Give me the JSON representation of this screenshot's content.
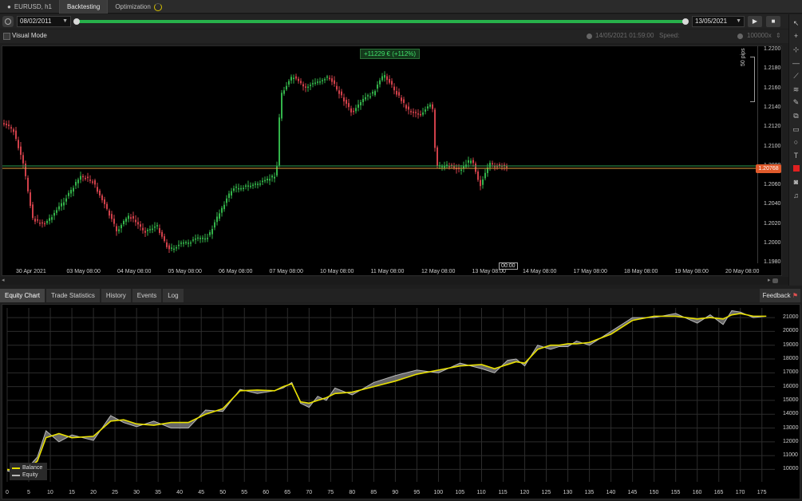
{
  "tabs": [
    {
      "label": "EURUSD, h1",
      "active": false
    },
    {
      "label": "Backtesting",
      "active": true
    },
    {
      "label": "Optimization",
      "active": false
    }
  ],
  "toolbar": {
    "start_date": "08/02/2011",
    "end_date": "13/05/2021",
    "play_icon": "▶",
    "stop_icon": "■"
  },
  "visual_mode": {
    "label": "Visual Mode",
    "checked": false,
    "current_time": "14/05/2021 01:59:00",
    "speed_label": "Speed:",
    "speed_value": "100000x"
  },
  "chart": {
    "pnl_label": "+11229 € (+112%)",
    "current_price": "1.20768",
    "pips_label": "50 pips",
    "time_marker": "00:00",
    "price_axis": [
      "1.2200",
      "1.2180",
      "1.2160",
      "1.2140",
      "1.2120",
      "1.2100",
      "1.2080",
      "1.2060",
      "1.2040",
      "1.2020",
      "1.2000",
      "1.1980"
    ],
    "time_axis": [
      "30 Apr 2021",
      "03 May 08:00",
      "04 May 08:00",
      "05 May 08:00",
      "06 May 08:00",
      "07 May 08:00",
      "10 May 08:00",
      "11 May 08:00",
      "12 May 08:00",
      "13 May 08:00",
      "14 May 08:00",
      "17 May 08:00",
      "18 May 08:00",
      "19 May 08:00",
      "20 May 08:00"
    ],
    "colors": {
      "bull": "#33b34a",
      "bear": "#d0404a",
      "price_line": "#e0a040",
      "green_line": "#30a050"
    }
  },
  "chart_data": {
    "type": "line",
    "title": "",
    "xlabel": "",
    "ylabel": "",
    "x_ticks": [
      0,
      5,
      10,
      15,
      20,
      25,
      30,
      35,
      40,
      45,
      50,
      55,
      60,
      65,
      70,
      75,
      80,
      85,
      90,
      95,
      100,
      105,
      110,
      115,
      120,
      125,
      130,
      135,
      140,
      145,
      150,
      155,
      160,
      165,
      170,
      175
    ],
    "y_ticks": [
      10000,
      11000,
      12000,
      13000,
      14000,
      15000,
      16000,
      17000,
      18000,
      19000,
      20000,
      21000
    ],
    "xlim": [
      0,
      178
    ],
    "ylim": [
      9100,
      21700
    ],
    "legend": "bottom-left",
    "grid": true,
    "series": [
      {
        "name": "Balance",
        "color": "#e8e000",
        "x": [
          0,
          3,
          5,
          7,
          9,
          12,
          15,
          20,
          24,
          27,
          30,
          34,
          38,
          42,
          46,
          50,
          54,
          58,
          62,
          64,
          66,
          68,
          70,
          72,
          74,
          76,
          80,
          85,
          90,
          95,
          100,
          105,
          110,
          113,
          116,
          118,
          120,
          123,
          126,
          128,
          130,
          132,
          135,
          140,
          145,
          150,
          155,
          160,
          163,
          166,
          168,
          170,
          173,
          176
        ],
        "values": [
          10000,
          9900,
          10100,
          10600,
          12300,
          12600,
          12300,
          12400,
          13500,
          13600,
          13300,
          13200,
          13400,
          13400,
          14000,
          14400,
          15700,
          15750,
          15700,
          16000,
          16200,
          14900,
          14800,
          15000,
          15200,
          15500,
          15600,
          16000,
          16400,
          16900,
          17200,
          17500,
          17600,
          17300,
          17600,
          17800,
          17700,
          18700,
          19000,
          19000,
          19100,
          19100,
          19200,
          19800,
          20800,
          21100,
          21100,
          20900,
          21000,
          20900,
          21200,
          21300,
          21100,
          21100
        ]
      },
      {
        "name": "Equity",
        "color": "#b8b8b8",
        "x": [
          0,
          3,
          5,
          7,
          9,
          12,
          15,
          20,
          24,
          27,
          30,
          34,
          38,
          42,
          46,
          50,
          54,
          58,
          62,
          64,
          66,
          68,
          70,
          72,
          74,
          76,
          80,
          85,
          90,
          95,
          100,
          105,
          110,
          113,
          116,
          118,
          120,
          123,
          126,
          128,
          130,
          132,
          135,
          140,
          145,
          150,
          155,
          160,
          163,
          166,
          168,
          170,
          173,
          176
        ],
        "values": [
          9900,
          9600,
          10200,
          10900,
          12800,
          12000,
          12500,
          12100,
          13900,
          13400,
          13100,
          13500,
          13000,
          13000,
          14300,
          14200,
          15800,
          15500,
          15700,
          15900,
          16300,
          14800,
          14500,
          15300,
          15000,
          15900,
          15400,
          16300,
          16800,
          17200,
          17000,
          17700,
          17300,
          17000,
          17900,
          18000,
          17500,
          19000,
          18700,
          18900,
          18900,
          19300,
          19000,
          20000,
          21000,
          21000,
          21300,
          20600,
          21200,
          20500,
          21500,
          21400,
          21000,
          21100
        ]
      }
    ]
  },
  "bottom_tabs": [
    {
      "label": "Equity Chart",
      "active": true
    },
    {
      "label": "Trade Statistics",
      "active": false
    },
    {
      "label": "History",
      "active": false
    },
    {
      "label": "Events",
      "active": false
    },
    {
      "label": "Log",
      "active": false
    }
  ],
  "feedback_label": "Feedback",
  "legend": {
    "balance_label": "Balance",
    "equity_label": "Equity"
  },
  "icons": [
    "cursor-icon",
    "crosshair-icon",
    "zoom-icon",
    "horizontal-line-icon",
    "trend-line-icon",
    "fibonacci-icon",
    "pen-icon",
    "shapes-icon",
    "rectangle-icon",
    "circle-icon",
    "text-icon",
    "color-icon",
    "camera-icon",
    "bell-icon"
  ]
}
